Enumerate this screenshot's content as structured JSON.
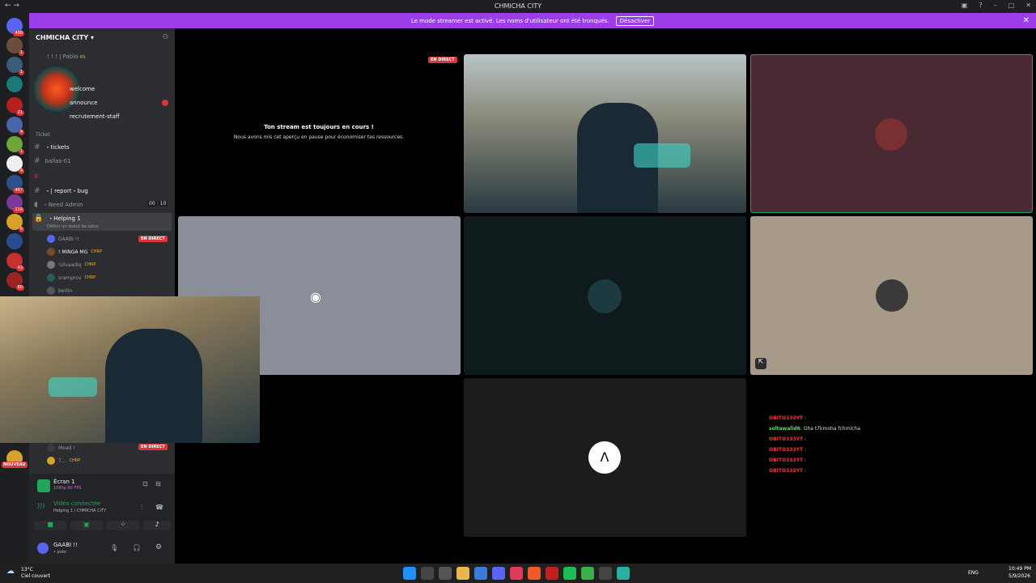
{
  "window": {
    "title": "CHMICHA CITY"
  },
  "banner": {
    "text": "Le mode streamer est activé. Les noms d'utilisateur ont été tronqués.",
    "button": "Désactiver"
  },
  "servers": {
    "badges": [
      "498",
      "1",
      "1",
      "21",
      "4",
      "1",
      "4",
      "467",
      "116",
      "6",
      "43",
      "60",
      "NOUVEAU"
    ]
  },
  "sidebar": {
    "guild_name": "CHMICHA CITY",
    "channels": {
      "pablo": "! ! !  | Pablo",
      "pablo_tag": "RS",
      "welcome": "welcome",
      "announce": "announce",
      "recrutement": "recrutement-staff",
      "ticket_category": "Ticket",
      "tickets": "・tickets",
      "ballas": "ballas-01",
      "report": "・| report・bug",
      "need_admin": "・Need Admin",
      "need_admin_counts": [
        "00",
        "10"
      ],
      "helping": "・Helping 1",
      "helping_status": "Définir un statut de salon"
    },
    "voice_users": [
      {
        "name": "GAABI !!",
        "live": "EN DIRECT"
      },
      {
        "name": "! MINGA MG",
        "tag": "CHRP"
      },
      {
        "name": "!Ulvaadiq",
        "tag": "CHRP"
      },
      {
        "name": "sramprov",
        "tag": "CHRP"
      },
      {
        "name": "berlin"
      },
      {
        "name": "Moad !",
        "live": "EN DIRECT"
      },
      {
        "name": "7...",
        "tag": "CHRP"
      }
    ]
  },
  "panel": {
    "stream_title": "Écran 1",
    "stream_sub": "1080p 60 FPS",
    "voice_status": "Vidéo connectée",
    "voice_channel": "Helping 1 / CHMICHA CITY",
    "username": "GAABI !!",
    "user_status": "• poto"
  },
  "stage": {
    "live_badge": "EN DIRECT",
    "paused_title": "Ton stream est toujours en cours !",
    "paused_sub": "Nous avons mis cet aperçu en pause pour économiser tes ressources."
  },
  "chat": [
    {
      "user": "OBITO333YT",
      "sep": ":",
      "msg": ""
    },
    {
      "user": "soltawalid6",
      "sep": ":",
      "msg": "Gha t7kmoha fchmicha"
    },
    {
      "user": "OBITO333YT",
      "sep": ":",
      "msg": ""
    },
    {
      "user": "OBITO333YT",
      "sep": ":",
      "msg": ""
    },
    {
      "user": "OBITO333YT",
      "sep": ":",
      "msg": ""
    },
    {
      "user": "OBITO333YT",
      "sep": ":",
      "msg": ""
    }
  ],
  "taskbar": {
    "weather_temp": "13°C",
    "weather_desc": "Ciel couvert",
    "lang": "ENG",
    "time": "10:49 PM",
    "date": "5/9/2026"
  },
  "colors": {
    "accent": "#9b3ee8",
    "live": "#da373c",
    "green": "#23a55a",
    "discord": "#5865f2"
  }
}
